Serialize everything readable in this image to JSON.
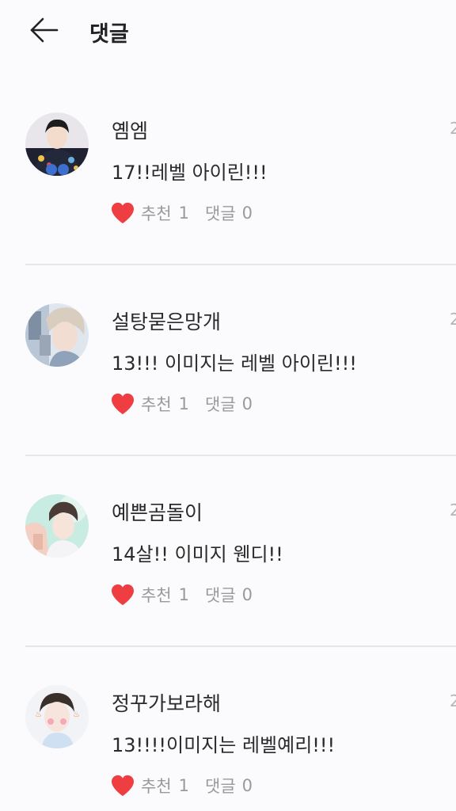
{
  "header": {
    "title": "댓글",
    "back_icon": "arrow-left-icon"
  },
  "comments": [
    {
      "author": "옘엠",
      "text": "17!!레벨 아이린!!!",
      "date_fragment": "2",
      "like_label": "추천",
      "like_count": "1",
      "reply_label": "댓글",
      "reply_count": "0"
    },
    {
      "author": "설탕묻은망개",
      "text": "13!!! 이미지는 레벨 아이린!!!",
      "date_fragment": "2",
      "like_label": "추천",
      "like_count": "1",
      "reply_label": "댓글",
      "reply_count": "0"
    },
    {
      "author": "예쁜곰돌이",
      "text": "14살!! 이미지 웬디!!",
      "date_fragment": "2",
      "like_label": "추천",
      "like_count": "1",
      "reply_label": "댓글",
      "reply_count": "0"
    },
    {
      "author": "정꾸가보라해",
      "text": "13!!!!이미지는 레벨예리!!!",
      "date_fragment": "2",
      "like_label": "추천",
      "like_count": "1",
      "reply_label": "댓글",
      "reply_count": "0"
    }
  ],
  "colors": {
    "heart": "#ef3e42",
    "meta_text": "#9a9a9a",
    "divider": "#e6e6e8"
  }
}
